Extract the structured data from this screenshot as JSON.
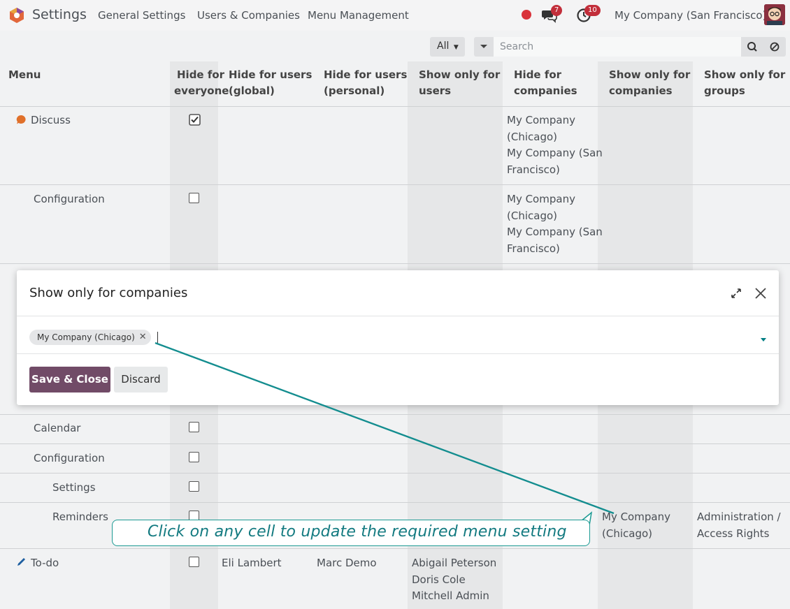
{
  "navbar": {
    "app_name": "Settings",
    "menus": [
      "General Settings",
      "Users & Companies",
      "Menu Management"
    ],
    "messages_count": "7",
    "activities_count": "10",
    "company": "My Company (San Francisco)"
  },
  "search": {
    "filter_label": "All",
    "placeholder": "Search"
  },
  "table": {
    "headers": {
      "menu": "Menu",
      "hide_everyone_1": "Hide for",
      "hide_everyone_2": "everyone",
      "hide_users_global_1": "Hide for users",
      "hide_users_global_2": "(global)",
      "hide_users_personal_1": "Hide for users",
      "hide_users_personal_2": "(personal)",
      "show_users_1": "Show only for",
      "show_users_2": "users",
      "hide_companies_1": "Hide for",
      "hide_companies_2": "companies",
      "show_companies_1": "Show only for",
      "show_companies_2": "companies",
      "show_groups_1": "Show only for",
      "show_groups_2": "groups"
    },
    "rows": {
      "discuss": {
        "menu": "Discuss",
        "hide_companies": [
          "My Company",
          "(Chicago)",
          "My Company (San",
          "Francisco)"
        ]
      },
      "configuration_top": {
        "menu": "Configuration",
        "hide_companies": [
          "My Company",
          "(Chicago)",
          "My Company (San",
          "Francisco)"
        ]
      },
      "calendar": {
        "menu": "Calendar"
      },
      "configuration": {
        "menu": "Configuration"
      },
      "settings": {
        "menu": "Settings"
      },
      "reminders": {
        "menu": "Reminders",
        "show_companies": [
          "My Company",
          "(Chicago)"
        ],
        "show_groups": [
          "Administration /",
          "Access Rights"
        ]
      },
      "todo": {
        "menu": "To-do",
        "hide_users_global": "Eli Lambert",
        "hide_users_personal": "Marc Demo",
        "show_users": [
          "Abigail Peterson",
          "Doris Cole",
          "Mitchell Admin"
        ]
      }
    }
  },
  "modal": {
    "title": "Show only for companies",
    "tag": "My Company (Chicago)",
    "save_label": "Save & Close",
    "discard_label": "Discard"
  },
  "annotation": {
    "text": "Click on any cell to update the required menu setting"
  }
}
